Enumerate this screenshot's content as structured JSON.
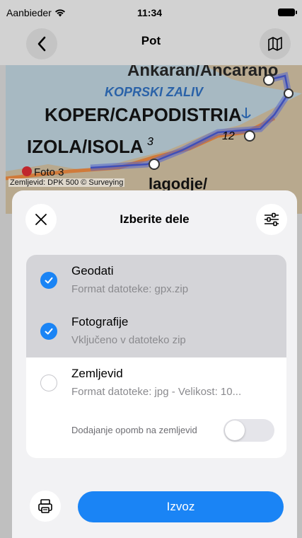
{
  "status_bar": {
    "carrier": "Aanbieder",
    "time": "11:34"
  },
  "nav": {
    "title": "Pot",
    "back_icon": "chevron-left-icon",
    "map_icon": "map-icon"
  },
  "map": {
    "labels": [
      "Ankaran/Ancarano",
      "KOPRSKI ZALIV",
      "KOPER/CAPODISTRIA",
      "IZOLA/ISOLA",
      "lagodje/"
    ],
    "numbers": [
      "3",
      "12"
    ],
    "photo_marker": "Foto 3",
    "attribution": "Zemljevid: DPK 500 © Surveying"
  },
  "sheet": {
    "title": "Izberite dele",
    "close_icon": "close-icon",
    "filter_icon": "sliders-icon",
    "items": [
      {
        "title": "Geodati",
        "subtitle": "Format datoteke: gpx.zip",
        "checked": true
      },
      {
        "title": "Fotografije",
        "subtitle": "Vključeno v datoteko zip",
        "checked": true
      },
      {
        "title": "Zemljevid",
        "subtitle": "Format datoteke: jpg - Velikost: 10...",
        "checked": false
      }
    ],
    "annotation_label": "Dodajanje opomb na zemljevid",
    "annotation_toggle": false,
    "print_icon": "printer-icon",
    "export_label": "Izvoz"
  },
  "colors": {
    "accent": "#1a84f5",
    "selected_row": "#d4d4d8",
    "sheet_bg": "#f2f2f4"
  }
}
